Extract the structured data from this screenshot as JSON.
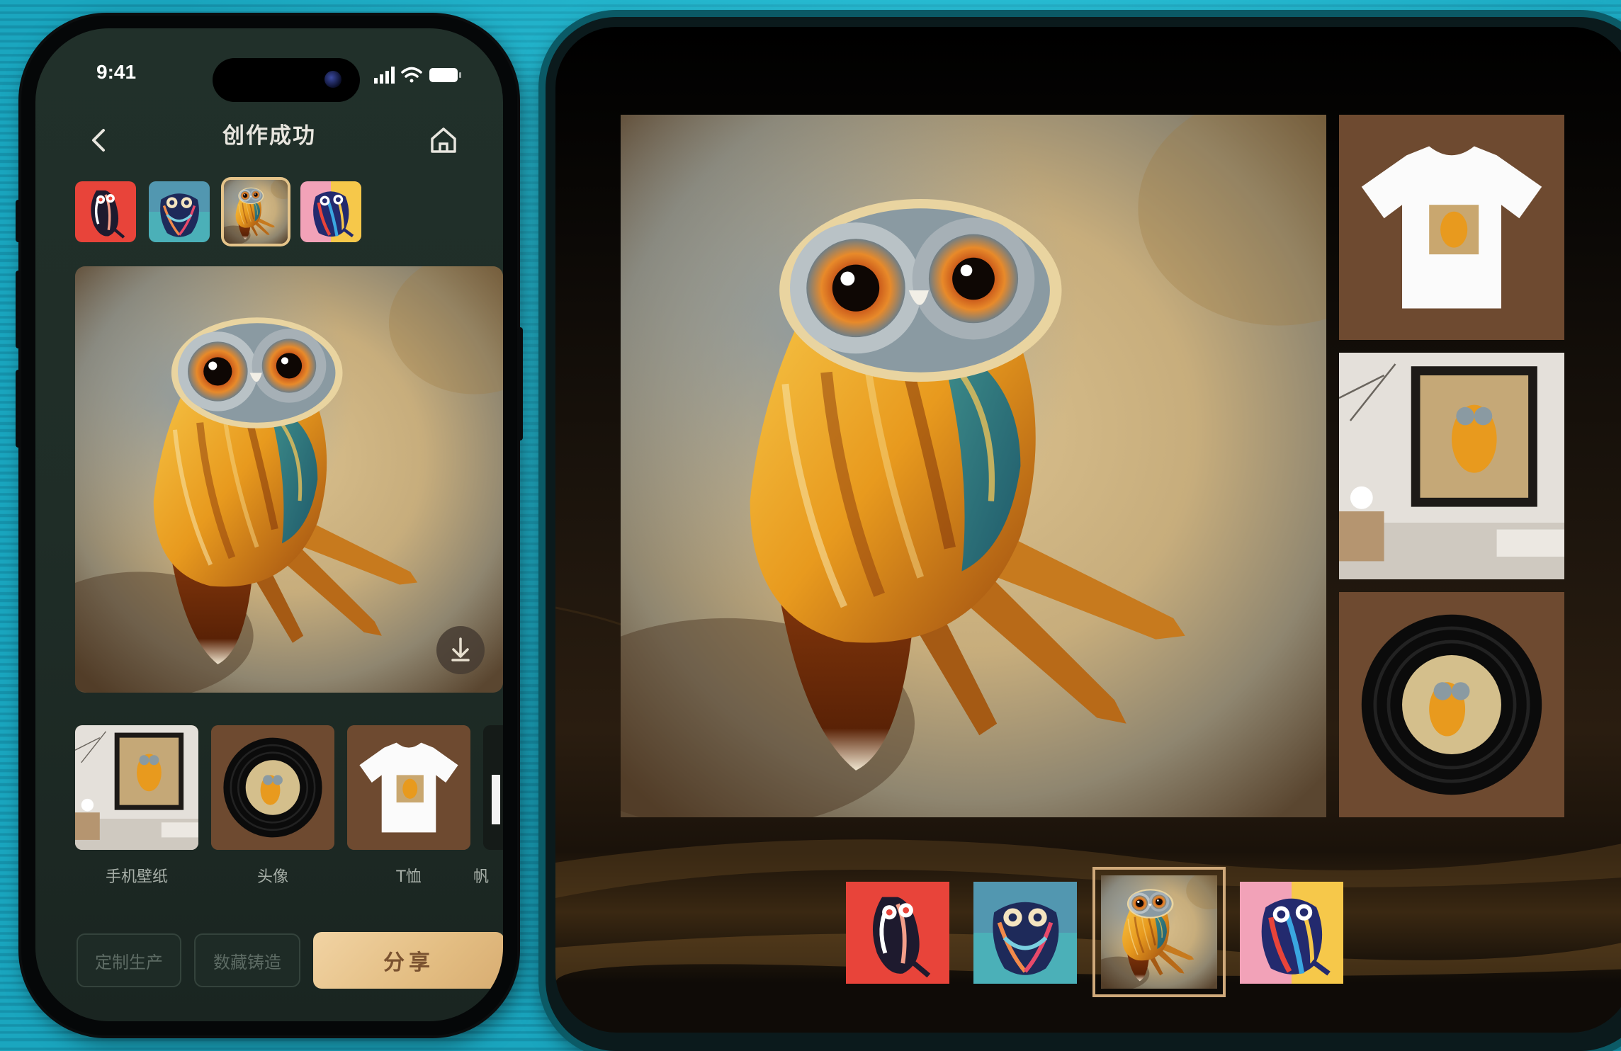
{
  "phone": {
    "status_time": "9:41",
    "nav_title": "创作成功",
    "products": [
      {
        "label": "手机壁纸",
        "icon": "wallpaper-mockup-image"
      },
      {
        "label": "头像",
        "icon": "vinyl-avatar-image"
      },
      {
        "label": "T恤",
        "icon": "tshirt-mockup-image"
      },
      {
        "label": "帆",
        "icon": "canvas-mockup-image"
      }
    ],
    "actions": {
      "custom_production": "定制生产",
      "digital_collectible": "数藏铸造",
      "share": "分享"
    }
  },
  "colors": {
    "accent_gold": "#e5c48a",
    "share_button": "#e3bd82",
    "phone_bg": "#21302a",
    "tile_brown": "#6e4a30"
  }
}
